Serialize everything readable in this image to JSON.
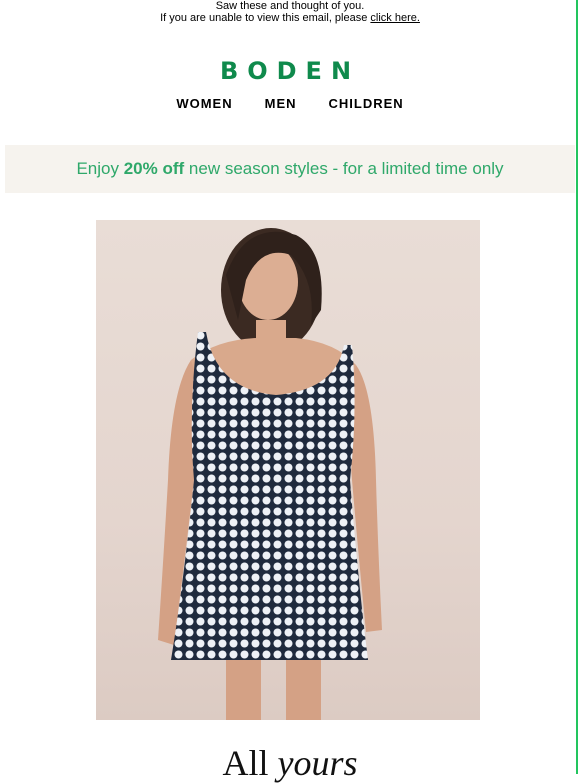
{
  "preheader": {
    "line1": "Saw these and thought of you.",
    "line2_prefix": "If you are unable to view this email, please ",
    "link": "click here."
  },
  "brand": {
    "logo": "BODEN",
    "accent_color": "#0f8a4c"
  },
  "nav": {
    "items": [
      {
        "label": "WOMEN"
      },
      {
        "label": "MEN"
      },
      {
        "label": "CHILDREN"
      }
    ]
  },
  "promo": {
    "prefix": "Enjoy ",
    "highlight": "20% off",
    "suffix": " new season styles - for a limited time only",
    "text_color": "#2fa86a"
  },
  "hero": {
    "image": "model-in-navy-polka-dot-shift-dress"
  },
  "headline": {
    "part1": "All ",
    "part2": "yours"
  }
}
